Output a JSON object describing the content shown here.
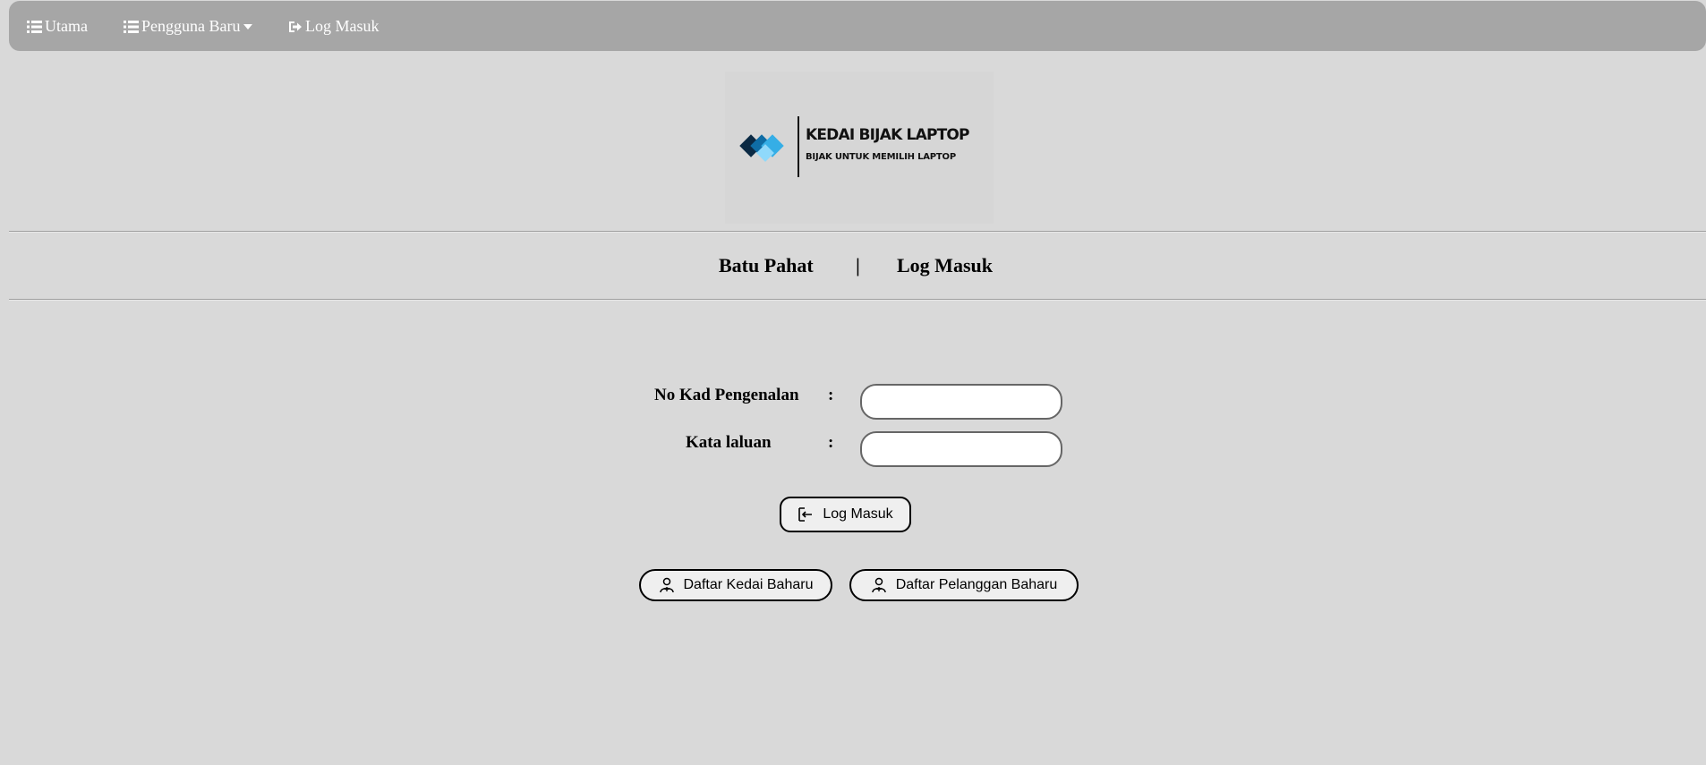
{
  "nav": {
    "items": [
      {
        "label": "Utama",
        "icon": "list-icon"
      },
      {
        "label": "Pengguna Baru",
        "icon": "list-icon",
        "dropdown": true
      },
      {
        "label": "Log Masuk",
        "icon": "sign-in-icon"
      }
    ]
  },
  "logo": {
    "title": "KEDAI BIJAK LAPTOP",
    "subtitle": "BIJAK UNTUK MEMILIH LAPTOP",
    "colors": [
      "#0b2a44",
      "#0f6da5",
      "#35aee6",
      "#8fd9fb"
    ]
  },
  "heading": {
    "location": "Batu Pahat",
    "separator": "|",
    "page": "Log Masuk"
  },
  "form": {
    "ic_label": "No Kad Pengenalan",
    "password_label": "Kata laluan",
    "colon": ":",
    "ic_value": "",
    "password_value": ""
  },
  "buttons": {
    "login": "Log Masuk",
    "register_shop": "Daftar Kedai Baharu",
    "register_customer": "Daftar Pelanggan Baharu"
  },
  "theme": {
    "background": "#d9d9d9",
    "navbar": "#a6a6a6"
  }
}
